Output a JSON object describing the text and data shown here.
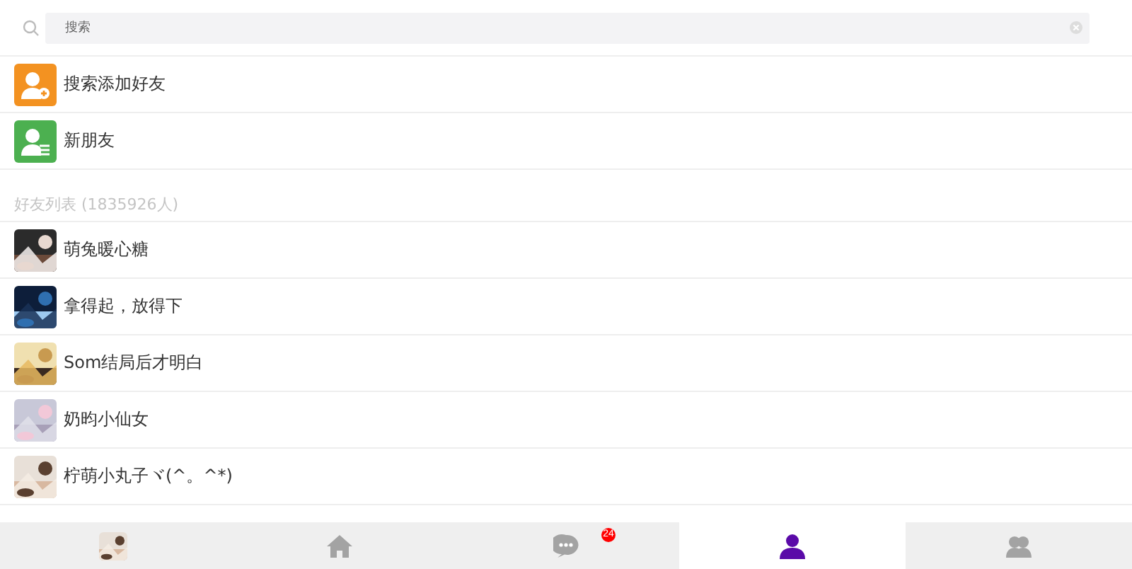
{
  "search": {
    "placeholder": "搜索"
  },
  "actions": [
    {
      "kind": "add-friend",
      "label": "搜索添加好友",
      "color": "#f39221"
    },
    {
      "kind": "new-friend",
      "label": "新朋友",
      "color": "#4cb050"
    }
  ],
  "friends_header": "好友列表 (1835926人)",
  "friends": [
    {
      "name": "萌兔暖心糖"
    },
    {
      "name": "拿得起，放得下"
    },
    {
      "name": "Som结局后才明白"
    },
    {
      "name": "奶昀小仙女"
    },
    {
      "name": "柠萌小丸子ヾ(^。^*)"
    }
  ],
  "tab_bar": [
    {
      "kind": "picture",
      "selected": false
    },
    {
      "kind": "home",
      "selected": false
    },
    {
      "kind": "chat",
      "selected": false,
      "badge": "24"
    },
    {
      "kind": "contacts",
      "selected": true
    },
    {
      "kind": "group",
      "selected": false
    }
  ]
}
